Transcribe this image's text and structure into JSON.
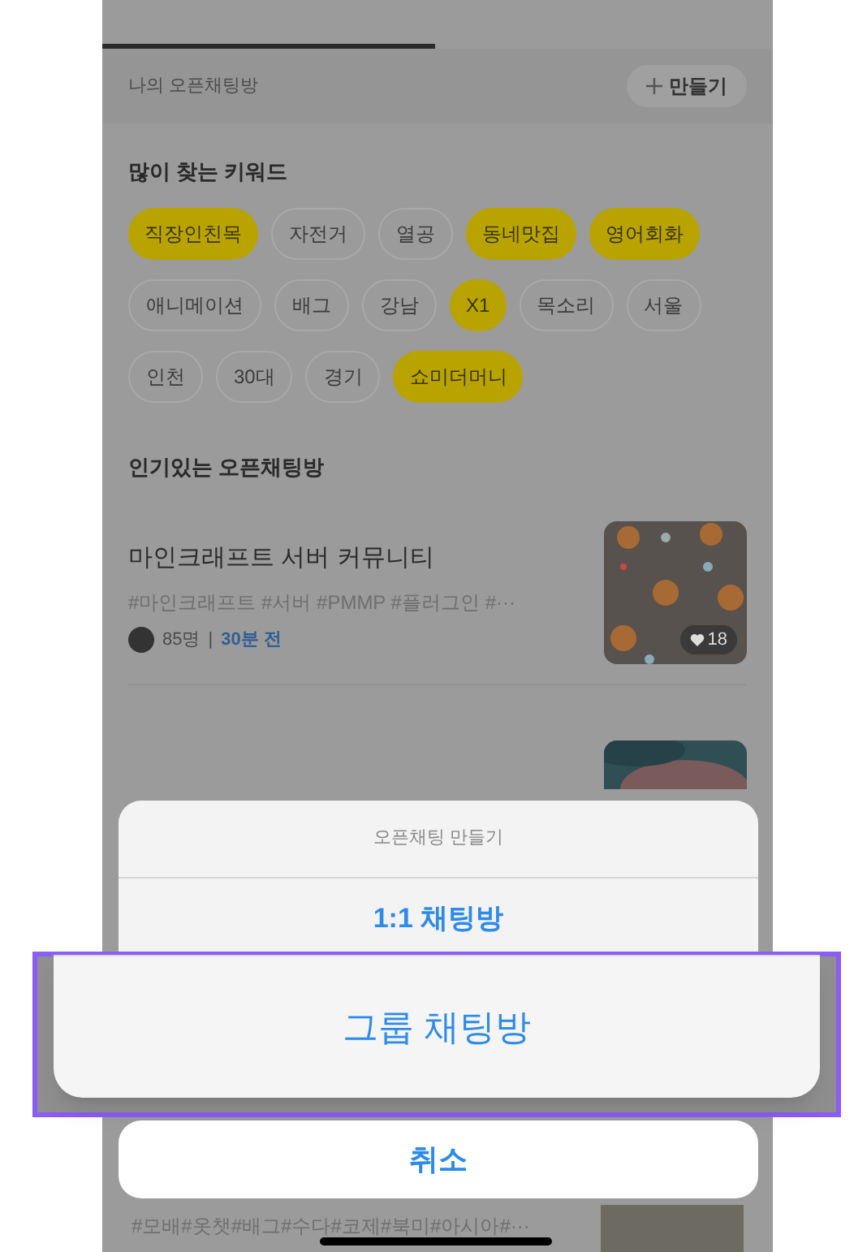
{
  "my_chats": {
    "label": "나의 오픈채팅방",
    "create_button": "만들기"
  },
  "keywords": {
    "title": "많이 찾는 키워드",
    "chips": [
      {
        "label": "직장인친목",
        "selected": true
      },
      {
        "label": "자전거",
        "selected": false
      },
      {
        "label": "열공",
        "selected": false
      },
      {
        "label": "동네맛집",
        "selected": true
      },
      {
        "label": "영어회화",
        "selected": true
      },
      {
        "label": "애니메이션",
        "selected": false
      },
      {
        "label": "배그",
        "selected": false
      },
      {
        "label": "강남",
        "selected": false
      },
      {
        "label": "X1",
        "selected": true
      },
      {
        "label": "목소리",
        "selected": false
      },
      {
        "label": "서울",
        "selected": false
      },
      {
        "label": "인천",
        "selected": false
      },
      {
        "label": "30대",
        "selected": false
      },
      {
        "label": "경기",
        "selected": false
      },
      {
        "label": "쇼미더머니",
        "selected": true
      }
    ]
  },
  "popular": {
    "title": "인기있는 오픈채팅방",
    "rooms": [
      {
        "title": "마인크래프트 서버 커뮤니티",
        "tags": "#마인크래프트 #서버 #PMMP #플러그인 #···",
        "members": "85명",
        "separator": "|",
        "time": "30분 전",
        "likes": "18"
      }
    ]
  },
  "last_room_tags": "#모배#옷챗#배그#수다#코제#북미#아시아#···",
  "action_sheet": {
    "title": "오픈채팅 만들기",
    "options": [
      {
        "label": "1:1 채팅방",
        "kind": "option"
      },
      {
        "label": "그룹 채팅방",
        "kind": "focused"
      }
    ],
    "cancel": "취소"
  }
}
